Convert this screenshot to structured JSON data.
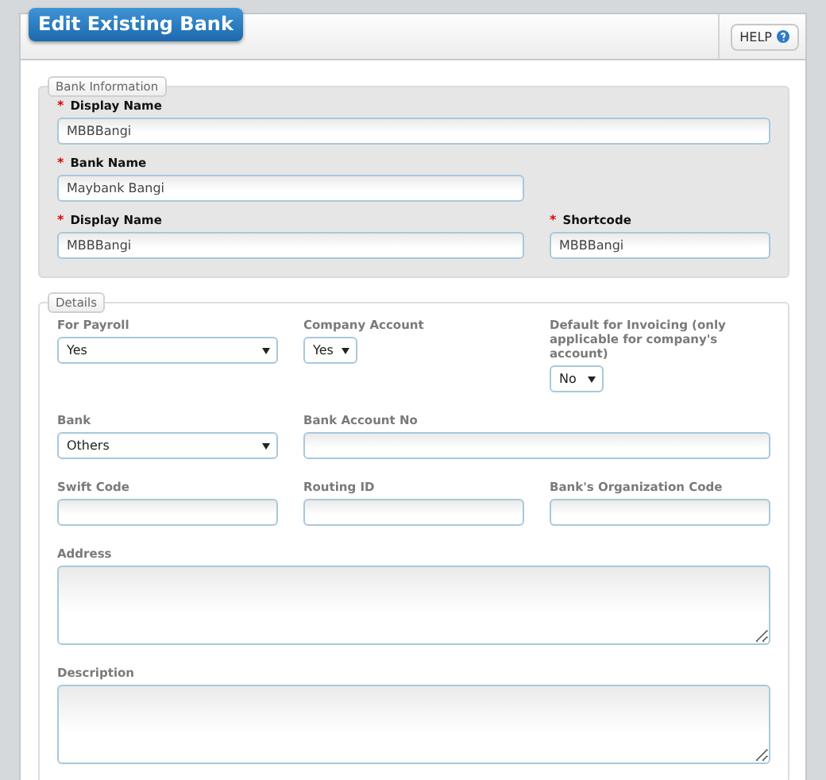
{
  "title": "Edit Existing Bank",
  "help_button": {
    "label": "HELP"
  },
  "sections": [
    {
      "legend": "Bank Information",
      "kind": "shaded",
      "rows": [
        [
          {
            "label": "Display Name",
            "marker": "*",
            "kind": "text",
            "value": "MBBBangi"
          }
        ],
        [
          {
            "label": "Bank Name",
            "marker": "*",
            "kind": "text",
            "value": "Maybank Bangi"
          }
        ],
        [
          {
            "label": "Display Name",
            "marker": "*",
            "kind": "text",
            "value": "MBBBangi"
          },
          {
            "label": "Shortcode",
            "marker": "*",
            "kind": "text",
            "value": "MBBBangi"
          }
        ]
      ]
    },
    {
      "legend": "Details",
      "kind": "plain",
      "rows": [
        [
          {
            "label": "For Payroll",
            "kind": "select",
            "value": "Yes"
          },
          {
            "label": "Company Account",
            "kind": "select",
            "value": "Yes"
          },
          {
            "label": "Default for Invoicing (only applicable for company's account)",
            "kind": "select",
            "value": "No"
          }
        ],
        [
          {
            "label": "Bank",
            "kind": "select",
            "value": "Others"
          },
          {
            "label": "Bank Account No",
            "kind": "text"
          }
        ],
        [
          {
            "label": "Swift Code",
            "kind": "text"
          },
          {
            "label": "Routing ID",
            "kind": "text"
          },
          {
            "label": "Bank's Organization Code",
            "kind": "text"
          }
        ],
        [
          {
            "label": "Address",
            "kind": "textarea"
          }
        ],
        [
          {
            "label": "Description",
            "kind": "textarea"
          }
        ]
      ]
    }
  ]
}
